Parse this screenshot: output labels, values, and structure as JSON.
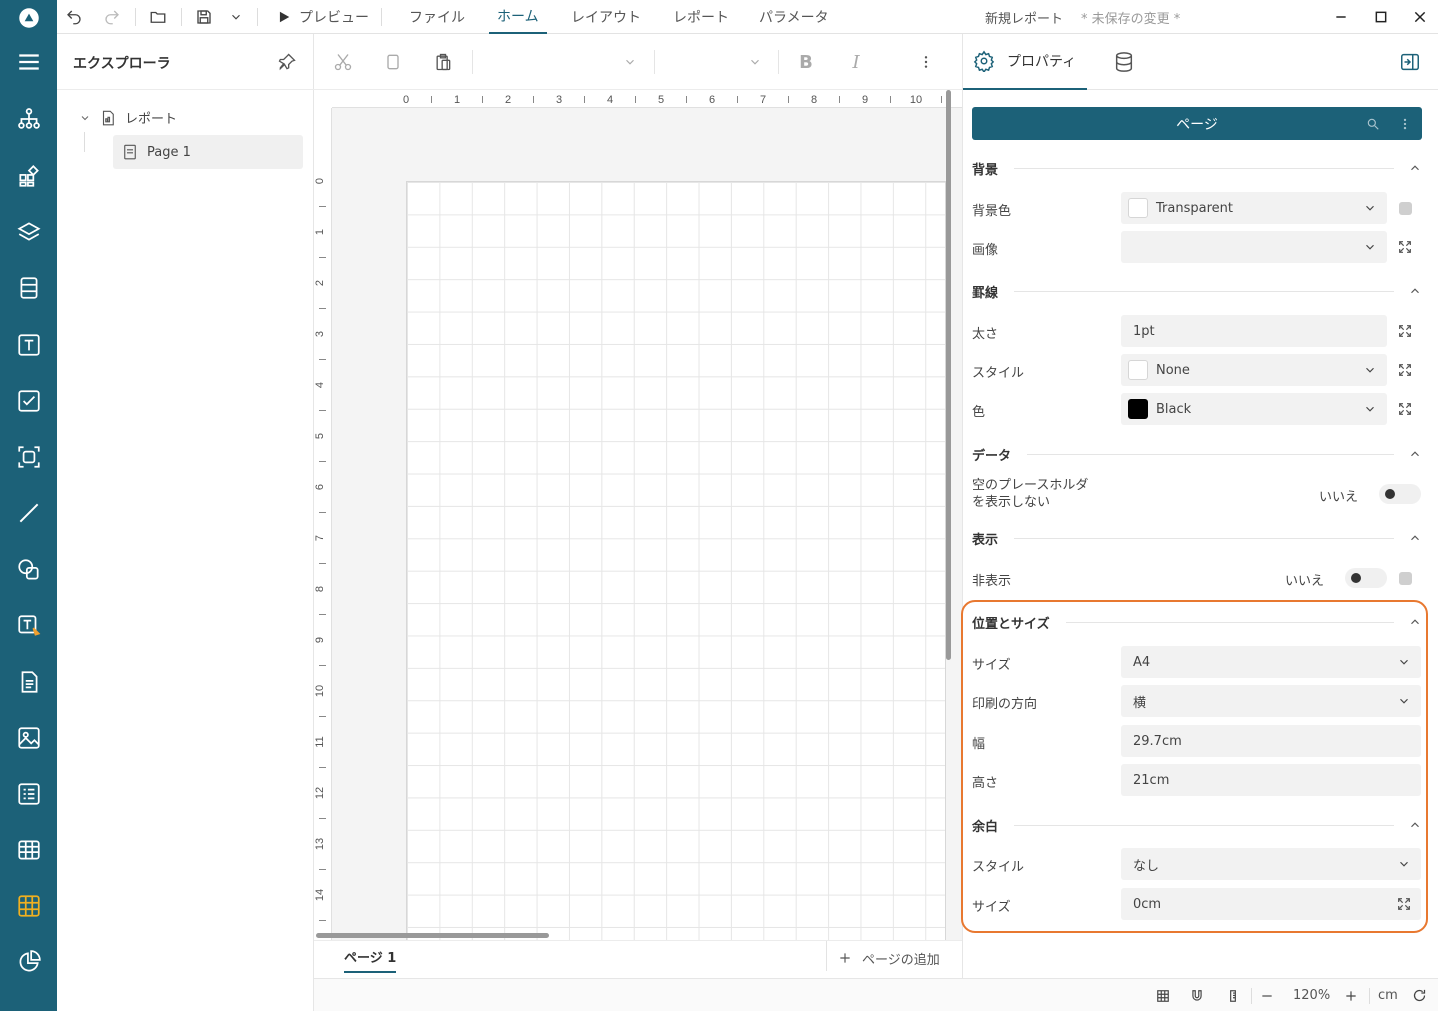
{
  "topbar": {
    "preview_label": "プレビュー",
    "menus": [
      "ファイル",
      "ホーム",
      "レイアウト",
      "レポート",
      "パラメータ"
    ],
    "doc_title": "新規レポート",
    "unsaved": "* 未保存の変更 *"
  },
  "explorer": {
    "title": "エクスプローラ",
    "tree_root": "レポート",
    "tree_child": "Page 1"
  },
  "ruler": {
    "h_ticks": [
      "0",
      "1",
      "2",
      "3",
      "4",
      "5",
      "6",
      "7",
      "8",
      "9",
      "10"
    ],
    "v_ticks": [
      "0",
      "1",
      "2",
      "3",
      "4",
      "5",
      "6",
      "7",
      "8",
      "9",
      "10",
      "11",
      "12",
      "13",
      "14"
    ]
  },
  "canvas": {
    "page_tab": "ページ 1",
    "add_page": "ページの追加"
  },
  "props": {
    "tab_properties": "プロパティ",
    "object_name": "ページ",
    "sections": {
      "background": "背景",
      "border": "罫線",
      "data": "データ",
      "display": "表示",
      "position_size": "位置とサイズ",
      "margin": "余白"
    },
    "labels": {
      "bg_color": "背景色",
      "image": "画像",
      "thickness": "太さ",
      "style": "スタイル",
      "color": "色",
      "empty_placeholder_line1": "空のプレースホルダ",
      "empty_placeholder_line2": "を表示しない",
      "hidden": "非表示",
      "size": "サイズ",
      "orientation": "印刷の方向",
      "width": "幅",
      "height": "高さ",
      "margin_style": "スタイル",
      "margin_size": "サイズ"
    },
    "values": {
      "bg_color": "Transparent",
      "image": "",
      "thickness": "1pt",
      "style": "None",
      "color": "Black",
      "empty_placeholder": "いいえ",
      "hidden": "いいえ",
      "size": "A4",
      "orientation": "横",
      "width": "29.7cm",
      "height": "21cm",
      "margin_style": "なし",
      "margin_size": "0cm"
    }
  },
  "status": {
    "zoom": "120%",
    "unit": "cm"
  },
  "colors": {
    "accent": "#1c6178",
    "highlight": "#e87830"
  }
}
